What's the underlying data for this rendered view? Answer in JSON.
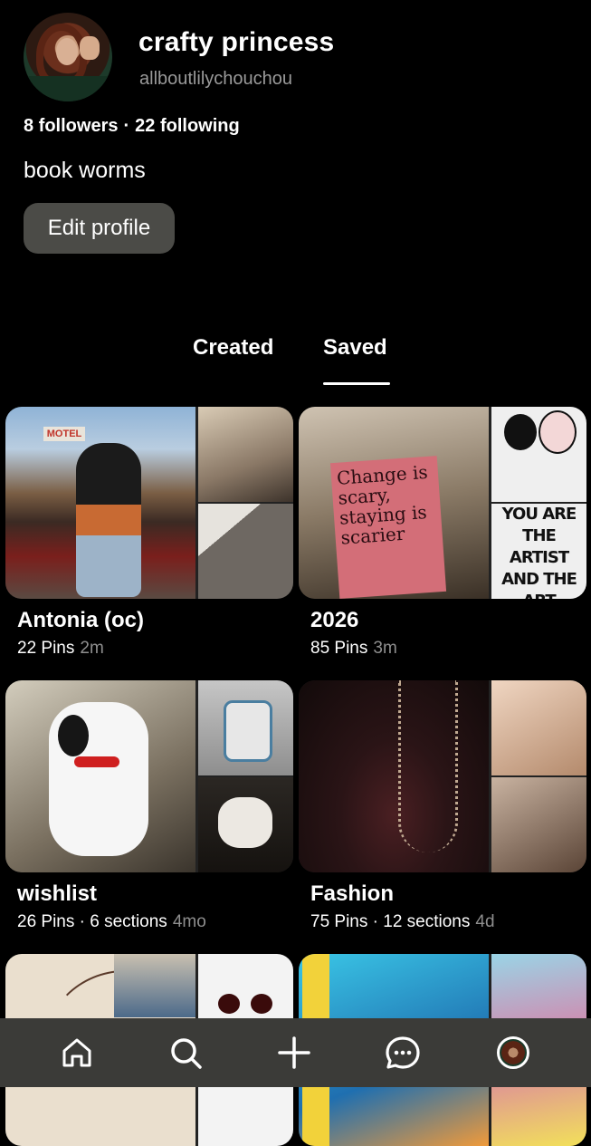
{
  "profile": {
    "name": "crafty princess",
    "handle": "allboutlilychouchou",
    "followers": "8 followers",
    "separator": "·",
    "following": "22 following",
    "bio": "book worms",
    "edit_label": "Edit profile"
  },
  "tabs": [
    {
      "label": "Created",
      "active": false
    },
    {
      "label": "Saved",
      "active": true
    }
  ],
  "boards": [
    {
      "title": "Antonia (oc)",
      "meta": "22 Pins",
      "age": "2m",
      "sign_text": "MOTEL"
    },
    {
      "title": "2026",
      "meta": "85 Pins",
      "age": "3m",
      "poster_text": "Change is scary, staying is scarier",
      "poster2_text": "YOU ARE THE ARTIST AND THE ART"
    },
    {
      "title": "wishlist",
      "meta": "26 Pins · 6 sections",
      "age": "4mo"
    },
    {
      "title": "Fashion",
      "meta": "75 Pins · 12 sections",
      "age": "4d"
    },
    {
      "title": "",
      "meta": "",
      "age": ""
    },
    {
      "title": "",
      "meta": "",
      "age": ""
    }
  ],
  "nav": {
    "icons": [
      "home-icon",
      "search-icon",
      "add-icon",
      "chat-icon",
      "profile-avatar"
    ]
  },
  "colors": {
    "background": "#000000",
    "button": "#4b4b47",
    "navbar": "#3b3b38",
    "muted_text": "#9a9a9a"
  }
}
